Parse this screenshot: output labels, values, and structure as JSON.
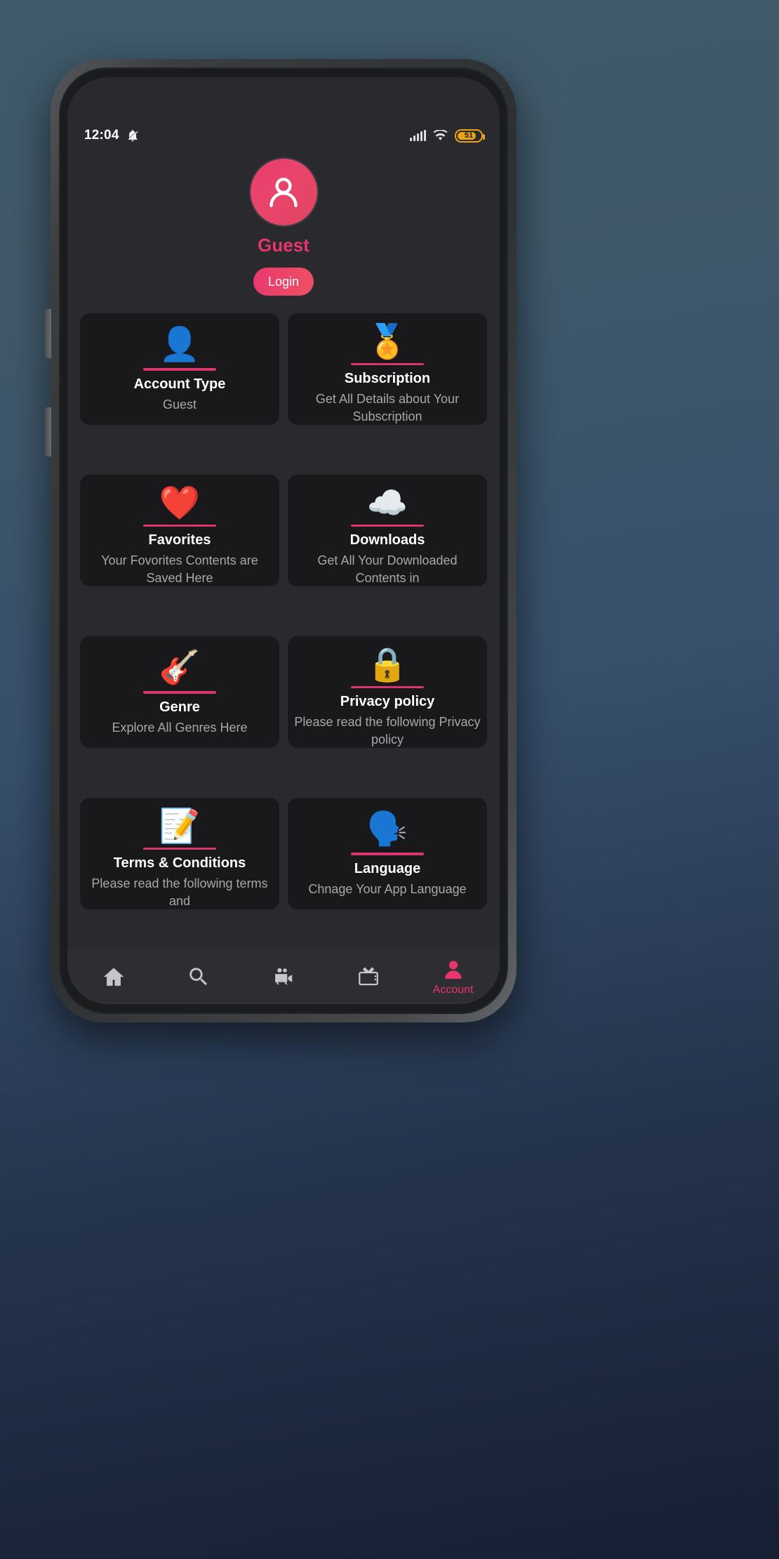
{
  "status_bar": {
    "clock": "12:04",
    "silent_icon": "bell-off-icon",
    "signal_icon": "signal-bars-icon",
    "wifi_icon": "wifi-icon",
    "battery_level": "51"
  },
  "profile": {
    "avatar_icon": "person-icon",
    "name": "Guest",
    "login_label": "Login"
  },
  "cards": [
    {
      "icon": "👤",
      "icon_name": "bust-in-silhouette-icon",
      "title": "Account Type",
      "subtitle": "Guest"
    },
    {
      "icon": "🏅",
      "icon_name": "laurel-star-medal-icon",
      "title": "Subscription",
      "subtitle": "Get All Details about Your Subscription"
    },
    {
      "icon": "❤️",
      "icon_name": "red-heart-icon",
      "title": "Favorites",
      "subtitle": "Your Fovorites Contents are Saved Here"
    },
    {
      "icon": "☁️",
      "icon_name": "cloud-download-icon",
      "title": "Downloads",
      "subtitle": "Get All Your Downloaded Contents in"
    },
    {
      "icon": "🎸",
      "icon_name": "mariachi-guitarist-icon",
      "title": "Genre",
      "subtitle": "Explore All Genres Here"
    },
    {
      "icon": "🔒",
      "icon_name": "locked-document-shield-icon",
      "title": "Privacy policy",
      "subtitle": "Please read the following Privacy policy"
    },
    {
      "icon": "📝",
      "icon_name": "terms-document-pencil-icon",
      "title": "Terms & Conditions",
      "subtitle": "Please read the following terms and"
    },
    {
      "icon": "🗣️",
      "icon_name": "language-bubbles-icon",
      "title": "Language",
      "subtitle": "Chnage Your App Language"
    }
  ],
  "bottom_nav": [
    {
      "icon_name": "home-icon",
      "label": ""
    },
    {
      "icon_name": "search-icon",
      "label": ""
    },
    {
      "icon_name": "movie-camera-icon",
      "label": ""
    },
    {
      "icon_name": "television-icon",
      "label": ""
    },
    {
      "icon_name": "account-person-icon",
      "label": "Account"
    }
  ],
  "colors": {
    "accent": "#e8356d",
    "card_bg": "#19191c",
    "screen_bg": "#2a2a2e",
    "battery": "#e8a317"
  }
}
